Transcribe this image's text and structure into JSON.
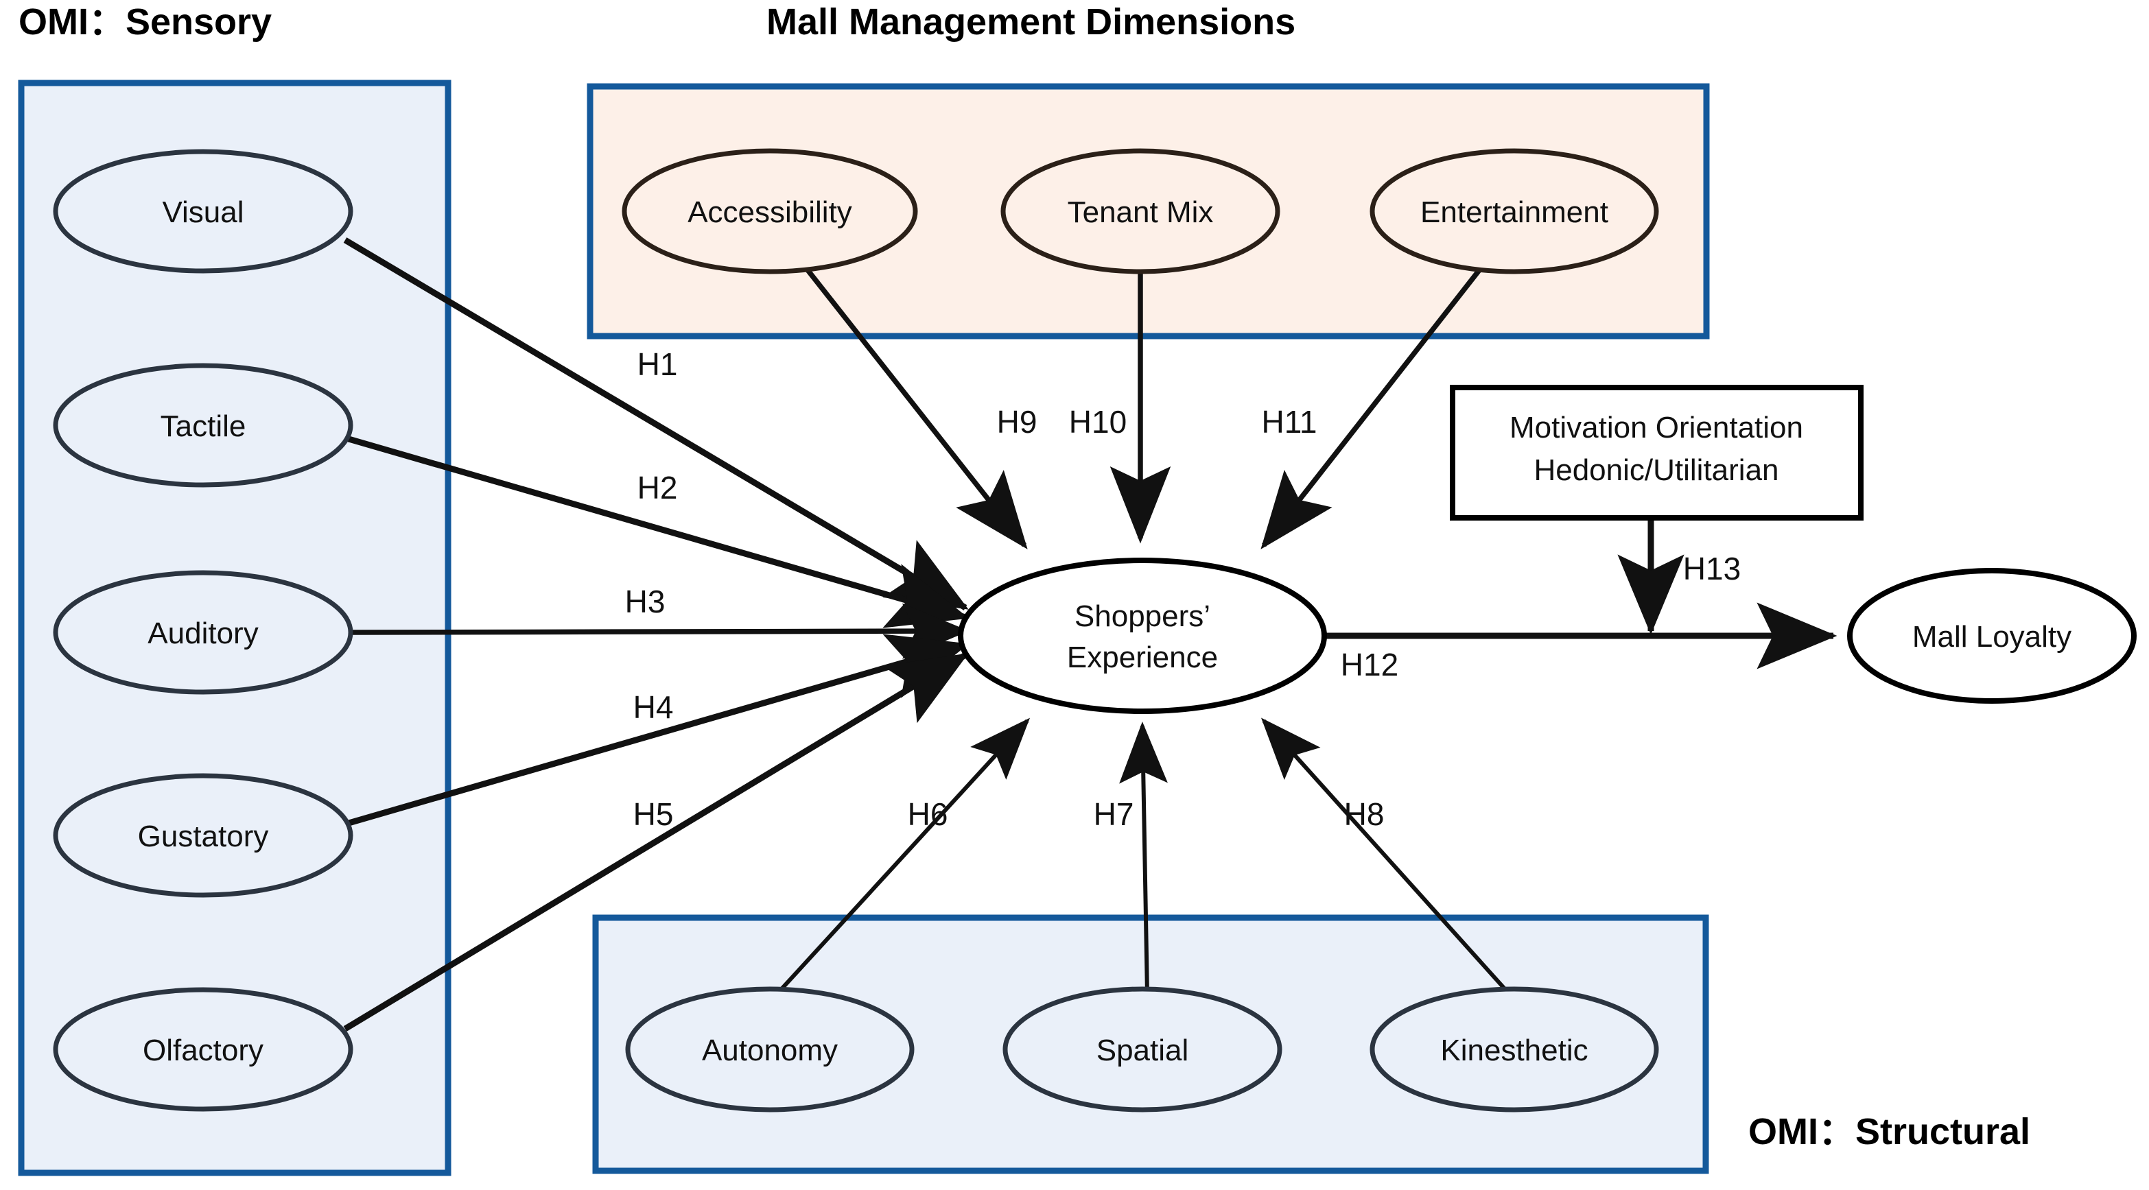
{
  "figure": {
    "type": "conceptual-model-diagram",
    "background": "#ffffff",
    "accent_blue": "#14599b",
    "fill_blue": "#eaf0f9",
    "fill_orange": "#fdf0e8",
    "line_color": "#111111"
  },
  "titles": {
    "sensory": "OMI：Sensory",
    "mall_management": "Mall Management Dimensions",
    "structural": "OMI：Structural"
  },
  "groups": {
    "sensory_box": {
      "label": "OMI：Sensory"
    },
    "management_box": {
      "label": "Mall Management Dimensions"
    },
    "structural_box": {
      "label": "OMI：Structural"
    }
  },
  "nodes": {
    "sensory": [
      {
        "id": "visual",
        "label": "Visual"
      },
      {
        "id": "tactile",
        "label": "Tactile"
      },
      {
        "id": "auditory",
        "label": "Auditory"
      },
      {
        "id": "gustatory",
        "label": "Gustatory"
      },
      {
        "id": "olfactory",
        "label": "Olfactory"
      }
    ],
    "management": [
      {
        "id": "accessibility",
        "label": "Accessibility"
      },
      {
        "id": "tenant-mix",
        "label": "Tenant Mix"
      },
      {
        "id": "entertainment",
        "label": "Entertainment"
      }
    ],
    "structural": [
      {
        "id": "autonomy",
        "label": "Autonomy"
      },
      {
        "id": "spatial",
        "label": "Spatial"
      },
      {
        "id": "kinesthetic",
        "label": "Kinesthetic"
      }
    ],
    "center": {
      "id": "shoppers-experience",
      "label_line1": "Shoppers’",
      "label_line2": "Experience"
    },
    "moderator": {
      "id": "motivation-orientation",
      "label_line1": "Motivation Orientation",
      "label_line2": "Hedonic/Utilitarian"
    },
    "outcome": {
      "id": "mall-loyalty",
      "label": "Mall Loyalty"
    }
  },
  "hypotheses": [
    {
      "id": "H1",
      "label": "H1",
      "from": "Visual",
      "to": "Shoppers’ Experience"
    },
    {
      "id": "H2",
      "label": "H2",
      "from": "Tactile",
      "to": "Shoppers’ Experience"
    },
    {
      "id": "H3",
      "label": "H3",
      "from": "Auditory",
      "to": "Shoppers’ Experience"
    },
    {
      "id": "H4",
      "label": "H4",
      "from": "Gustatory",
      "to": "Shoppers’ Experience"
    },
    {
      "id": "H5",
      "label": "H5",
      "from": "Olfactory",
      "to": "Shoppers’ Experience"
    },
    {
      "id": "H6",
      "label": "H6",
      "from": "Autonomy",
      "to": "Shoppers’ Experience"
    },
    {
      "id": "H7",
      "label": "H7",
      "from": "Spatial",
      "to": "Shoppers’ Experience"
    },
    {
      "id": "H8",
      "label": "H8",
      "from": "Kinesthetic",
      "to": "Shoppers’ Experience"
    },
    {
      "id": "H9",
      "label": "H9",
      "from": "Accessibility",
      "to": "Shoppers’ Experience"
    },
    {
      "id": "H10",
      "label": "H10",
      "from": "Tenant Mix",
      "to": "Shoppers’ Experience"
    },
    {
      "id": "H11",
      "label": "H11",
      "from": "Entertainment",
      "to": "Shoppers’ Experience"
    },
    {
      "id": "H12",
      "label": "H12",
      "from": "Shoppers’ Experience",
      "to": "Mall Loyalty"
    },
    {
      "id": "H13",
      "label": "H13",
      "from": "Motivation Orientation Hedonic/Utilitarian",
      "to": "H12 path (moderation)"
    }
  ]
}
